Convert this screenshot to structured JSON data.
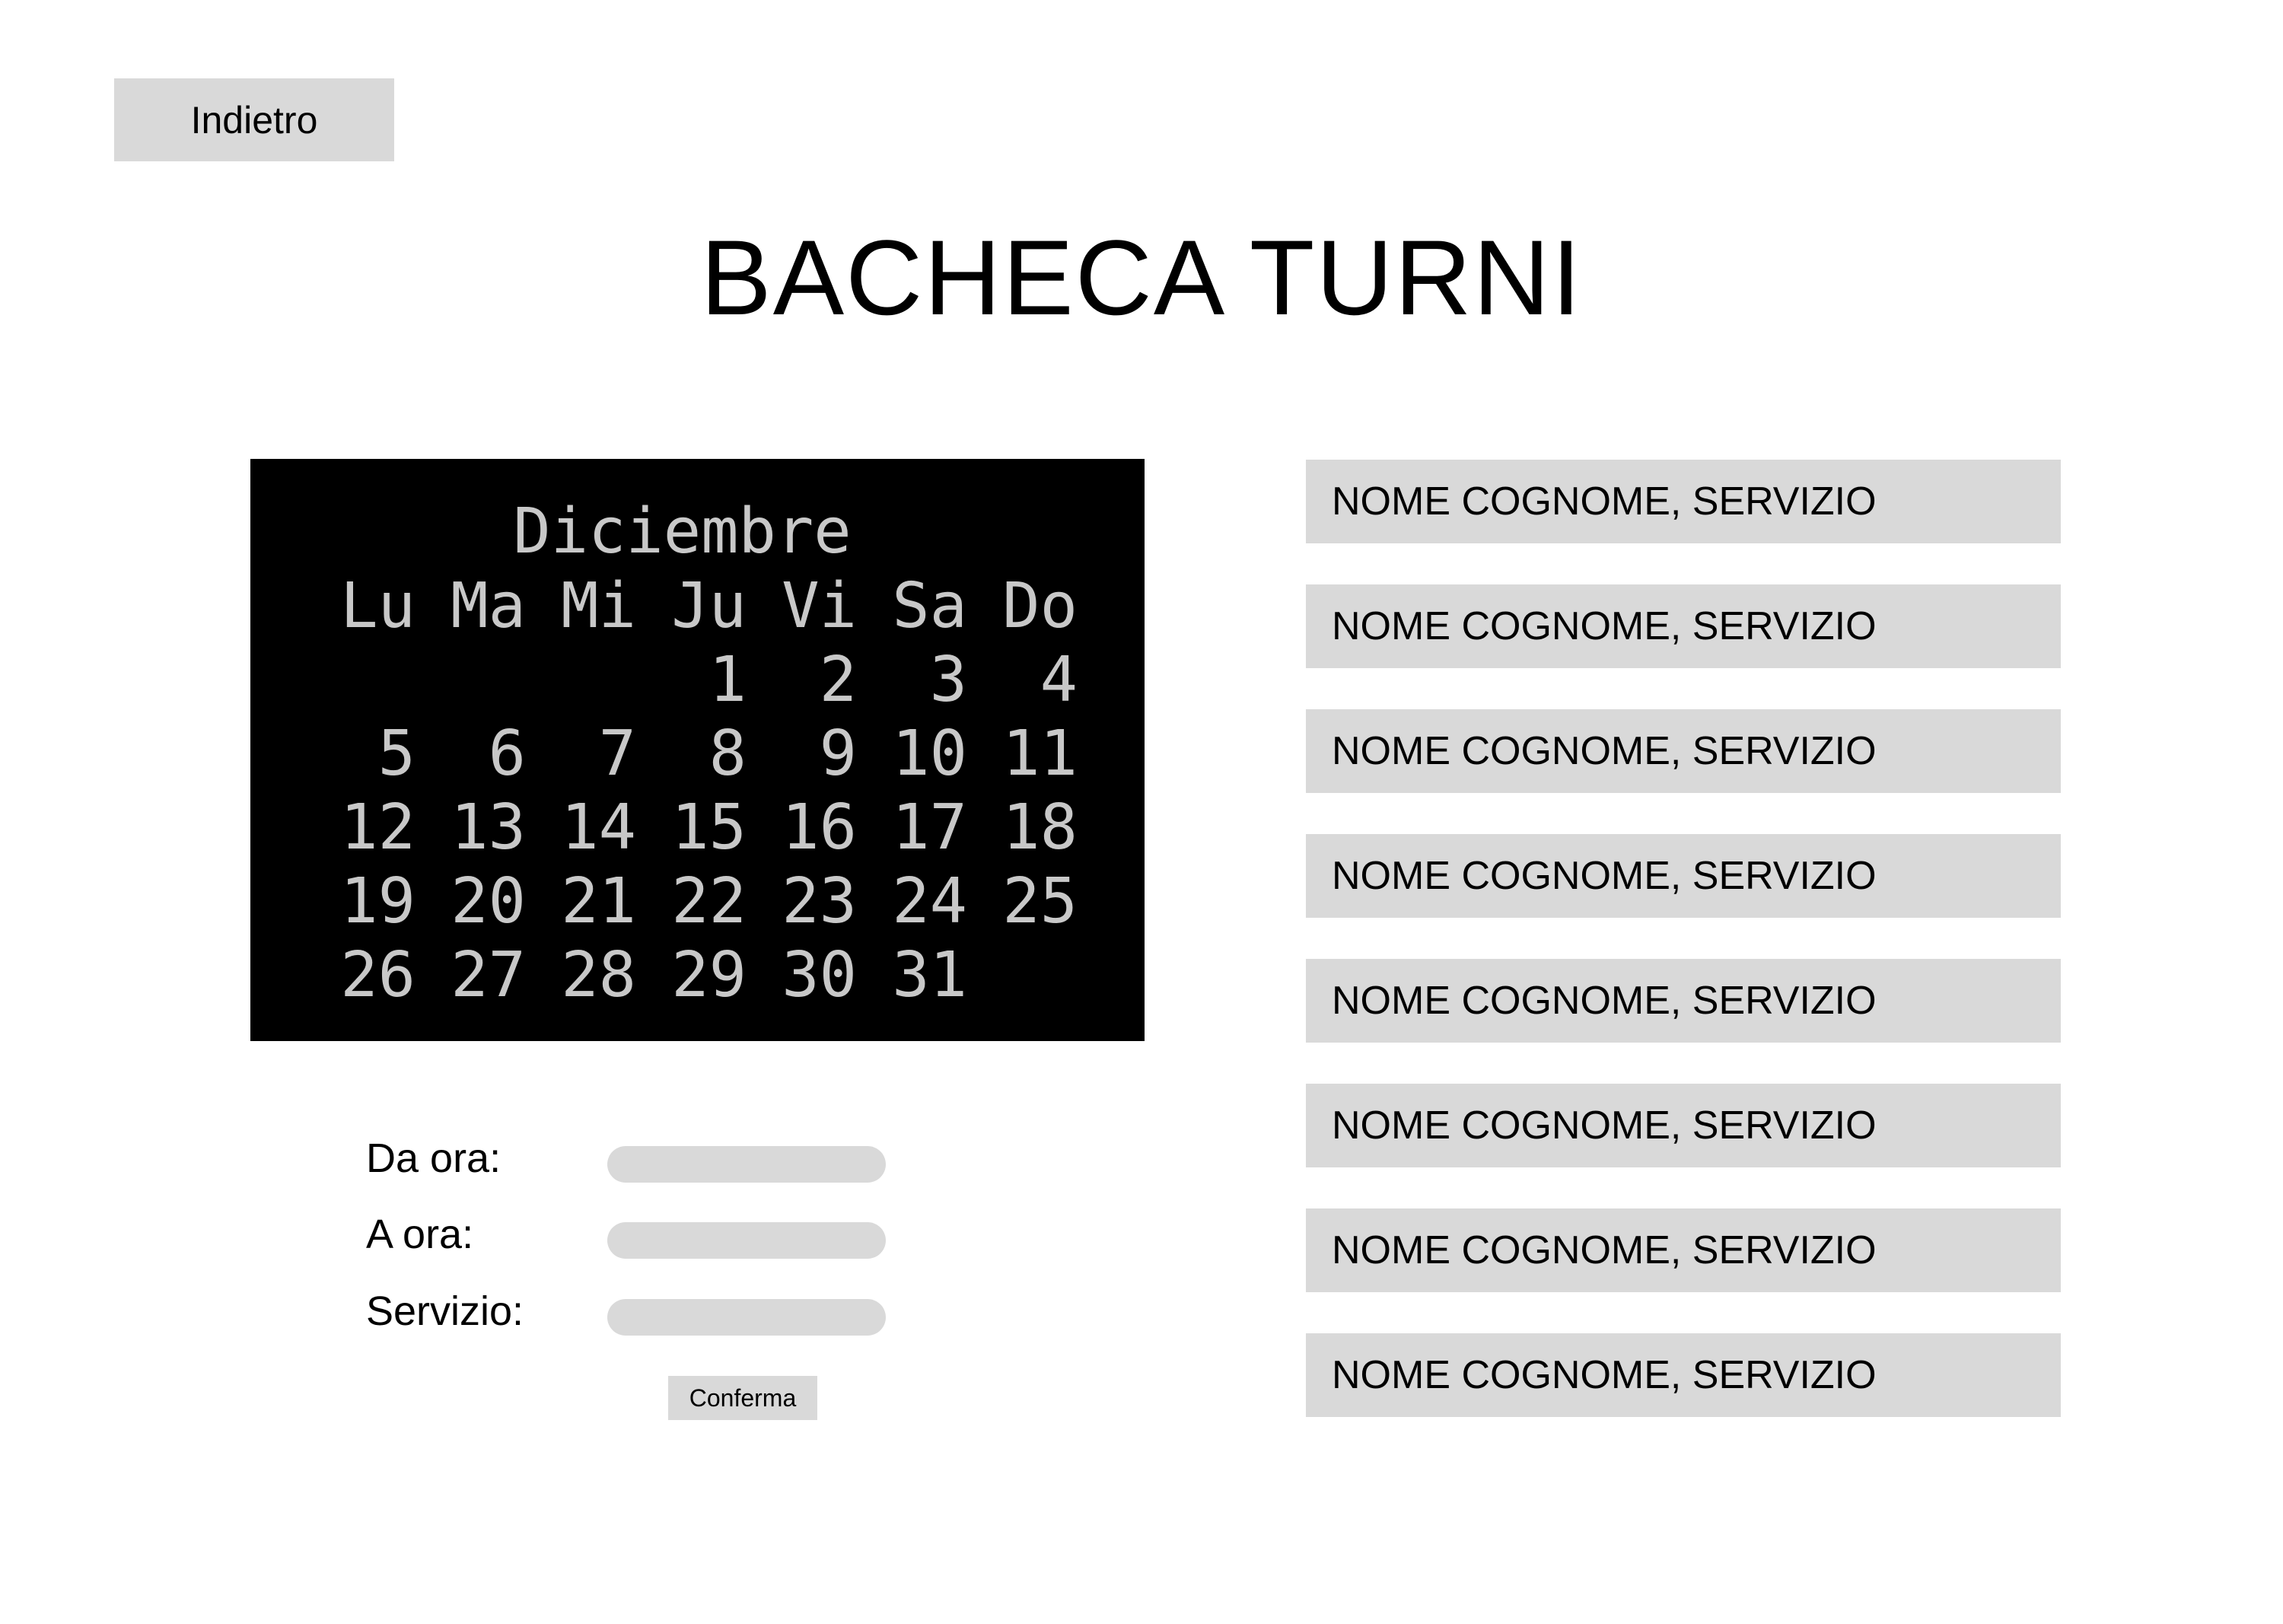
{
  "header": {
    "back_label": "Indietro",
    "title": "BACHECA TURNI"
  },
  "calendar": {
    "month": "Diciembre",
    "weekdays": [
      "Lu",
      "Ma",
      "Mi",
      "Ju",
      "Vi",
      "Sa",
      "Do"
    ],
    "leading_blanks": 3,
    "days": [
      "1",
      "2",
      "3",
      "4",
      "5",
      "6",
      "7",
      "8",
      "9",
      "10",
      "11",
      "12",
      "13",
      "14",
      "15",
      "16",
      "17",
      "18",
      "19",
      "20",
      "21",
      "22",
      "23",
      "24",
      "25",
      "26",
      "27",
      "28",
      "29",
      "30",
      "31"
    ]
  },
  "form": {
    "from_label": "Da ora:",
    "from_value": "",
    "to_label": "A ora:",
    "to_value": "",
    "service_label": "Servizio:",
    "service_value": "",
    "confirm_label": "Conferma"
  },
  "shifts": [
    {
      "label": "NOME COGNOME, SERVIZIO"
    },
    {
      "label": "NOME COGNOME, SERVIZIO"
    },
    {
      "label": "NOME COGNOME, SERVIZIO"
    },
    {
      "label": "NOME COGNOME, SERVIZIO"
    },
    {
      "label": "NOME COGNOME, SERVIZIO"
    },
    {
      "label": "NOME COGNOME, SERVIZIO"
    },
    {
      "label": "NOME COGNOME, SERVIZIO"
    },
    {
      "label": "NOME COGNOME, SERVIZIO"
    }
  ],
  "colors": {
    "button_bg": "#d9d9d9",
    "calendar_bg": "#000000",
    "calendar_text": "#c8c8c8"
  }
}
